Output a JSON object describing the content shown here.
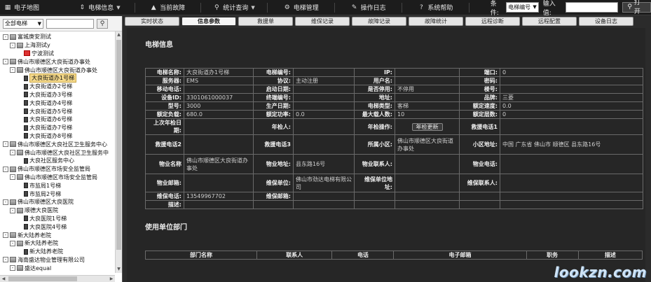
{
  "topbar": {
    "items": [
      {
        "label": "电子地图",
        "icon": "grid-icon",
        "caret": false
      },
      {
        "label": "电梯信息",
        "icon": "updown-icon",
        "caret": true
      },
      {
        "label": "当前故障",
        "icon": "warning-icon",
        "caret": false
      },
      {
        "label": "统计查询",
        "icon": "search-icon",
        "caret": true
      },
      {
        "label": "电梯管理",
        "icon": "gear-icon",
        "caret": false
      },
      {
        "label": "操作日志",
        "icon": "edit-icon",
        "caret": false
      },
      {
        "label": "系统帮助",
        "icon": "help-icon",
        "caret": false
      }
    ],
    "condition_label": "条件:",
    "condition_value": "电梯编号",
    "input_label": "输入值:",
    "input_value": "",
    "open_label": "打开"
  },
  "left_panel": {
    "filter_value": "全部电梯",
    "search_value": "",
    "tree": [
      {
        "level": 0,
        "toggle": "-",
        "icon": "building",
        "label": "富城庚安测试"
      },
      {
        "level": 1,
        "toggle": "-",
        "icon": "building",
        "label": "上海测试y"
      },
      {
        "level": 2,
        "toggle": "",
        "icon": "camera",
        "label": "宁波测试"
      },
      {
        "level": 0,
        "toggle": "-",
        "icon": "building",
        "label": "佛山市顺德区大良街道办事处"
      },
      {
        "level": 1,
        "toggle": "-",
        "icon": "building",
        "label": "佛山市顺德区大良街道办事处"
      },
      {
        "level": 2,
        "toggle": "",
        "icon": "car",
        "label": "大良街道办1号梯",
        "selected": true
      },
      {
        "level": 2,
        "toggle": "",
        "icon": "car",
        "label": "大良街道办2号梯"
      },
      {
        "level": 2,
        "toggle": "",
        "icon": "car",
        "label": "大良街道办3号梯"
      },
      {
        "level": 2,
        "toggle": "",
        "icon": "car",
        "label": "大良街道办4号梯"
      },
      {
        "level": 2,
        "toggle": "",
        "icon": "car",
        "label": "大良街道办5号梯"
      },
      {
        "level": 2,
        "toggle": "",
        "icon": "car",
        "label": "大良街道办6号梯"
      },
      {
        "level": 2,
        "toggle": "",
        "icon": "car",
        "label": "大良街道办7号梯"
      },
      {
        "level": 2,
        "toggle": "",
        "icon": "car",
        "label": "大良街道办8号梯"
      },
      {
        "level": 0,
        "toggle": "-",
        "icon": "building",
        "label": "佛山市顺德区大良社区卫生服务中心"
      },
      {
        "level": 1,
        "toggle": "-",
        "icon": "building",
        "label": "佛山市顺德区大良社区卫生服务中"
      },
      {
        "level": 2,
        "toggle": "",
        "icon": "car",
        "label": "大良社区服务中心"
      },
      {
        "level": 0,
        "toggle": "-",
        "icon": "building",
        "label": "佛山市顺德区市场安全监管局"
      },
      {
        "level": 1,
        "toggle": "-",
        "icon": "building",
        "label": "佛山市顺德区市场安全监管局"
      },
      {
        "level": 2,
        "toggle": "",
        "icon": "car",
        "label": "市监局1号梯"
      },
      {
        "level": 2,
        "toggle": "",
        "icon": "car",
        "label": "市监局2号梯"
      },
      {
        "level": 0,
        "toggle": "-",
        "icon": "building",
        "label": "佛山市顺德区大良医院"
      },
      {
        "level": 1,
        "toggle": "-",
        "icon": "building",
        "label": "顺德大良医院"
      },
      {
        "level": 2,
        "toggle": "",
        "icon": "car",
        "label": "大良医院1号梯"
      },
      {
        "level": 2,
        "toggle": "",
        "icon": "car",
        "label": "大良医院4号梯"
      },
      {
        "level": 0,
        "toggle": "-",
        "icon": "building",
        "label": "新大陆养老院"
      },
      {
        "level": 1,
        "toggle": "-",
        "icon": "building",
        "label": "新大陆养老院"
      },
      {
        "level": 2,
        "toggle": "",
        "icon": "car",
        "label": "新大陆养老院"
      },
      {
        "level": 0,
        "toggle": "-",
        "icon": "building",
        "label": "海南盛达物业管理有限公司"
      },
      {
        "level": 1,
        "toggle": "-",
        "icon": "building",
        "label": "盛达equal"
      }
    ]
  },
  "tabs": [
    {
      "label": "实时状态",
      "active": false
    },
    {
      "label": "信息参数",
      "active": true
    },
    {
      "label": "救援单",
      "active": false
    },
    {
      "label": "维保记录",
      "active": false
    },
    {
      "label": "故障记录",
      "active": false
    },
    {
      "label": "故障统计",
      "active": false
    },
    {
      "label": "远程诊断",
      "active": false
    },
    {
      "label": "远程配置",
      "active": false
    },
    {
      "label": "设备日志",
      "active": false
    }
  ],
  "elevator_info": {
    "title": "电梯信息",
    "rows": [
      [
        "电梯名称:",
        "大良街道办1号梯",
        "电梯编号:",
        "",
        "IP:",
        "",
        "端口:",
        "0"
      ],
      [
        "服务器:",
        "EMS",
        "协议:",
        "主动注册",
        "用户名:",
        "",
        "密码:",
        ""
      ],
      [
        "移动电话:",
        "",
        "启动日期:",
        "",
        "是否停用:",
        "不停用",
        "楼号:",
        ""
      ],
      [
        "设备ID:",
        "3301061000037",
        "终端编号:",
        "",
        "地址:",
        "",
        "品牌:",
        "三菱"
      ],
      [
        "型号:",
        "3000",
        "生产日期:",
        "",
        "电梯类型:",
        "客梯",
        "额定速度:",
        "0.0"
      ],
      [
        "额定负载:",
        "680.0",
        "额定功率:",
        "0.0",
        "最大载人数:",
        "10",
        "额定层数:",
        "0"
      ],
      [
        "上次年检日期:",
        "",
        "年检人:",
        "",
        "年检操作:",
        "年检更新",
        "救援电话1",
        ""
      ],
      [
        "救援电话2",
        "",
        "救援电话3",
        "",
        "所属小区:",
        "佛山市顺德区大良街道办事处",
        "小区地址:",
        "中国 广东省 佛山市 顺德区 县东路16号"
      ],
      [
        "物业名称",
        "佛山市顺德区大良街道办事处",
        "物业地址:",
        "县东路16号",
        "物业联系人:",
        "",
        "物业电话:",
        ""
      ],
      [
        "物业邮箱:",
        "",
        "维保单位:",
        "佛山市劲达电梯有限公司",
        "维保单位地址:",
        "",
        "维保联系人:",
        ""
      ],
      [
        "维保电话:",
        "13549967702",
        "维保邮箱:",
        "",
        "",
        "",
        "",
        ""
      ],
      [
        "描述:",
        "",
        "",
        "",
        "",
        "",
        "",
        ""
      ]
    ]
  },
  "unit_section": {
    "title": "使用单位部门",
    "headers": [
      "部门名称",
      "联系人",
      "电话",
      "电子邮箱",
      "职务",
      "描述"
    ]
  },
  "watermark": "lookzn.com"
}
